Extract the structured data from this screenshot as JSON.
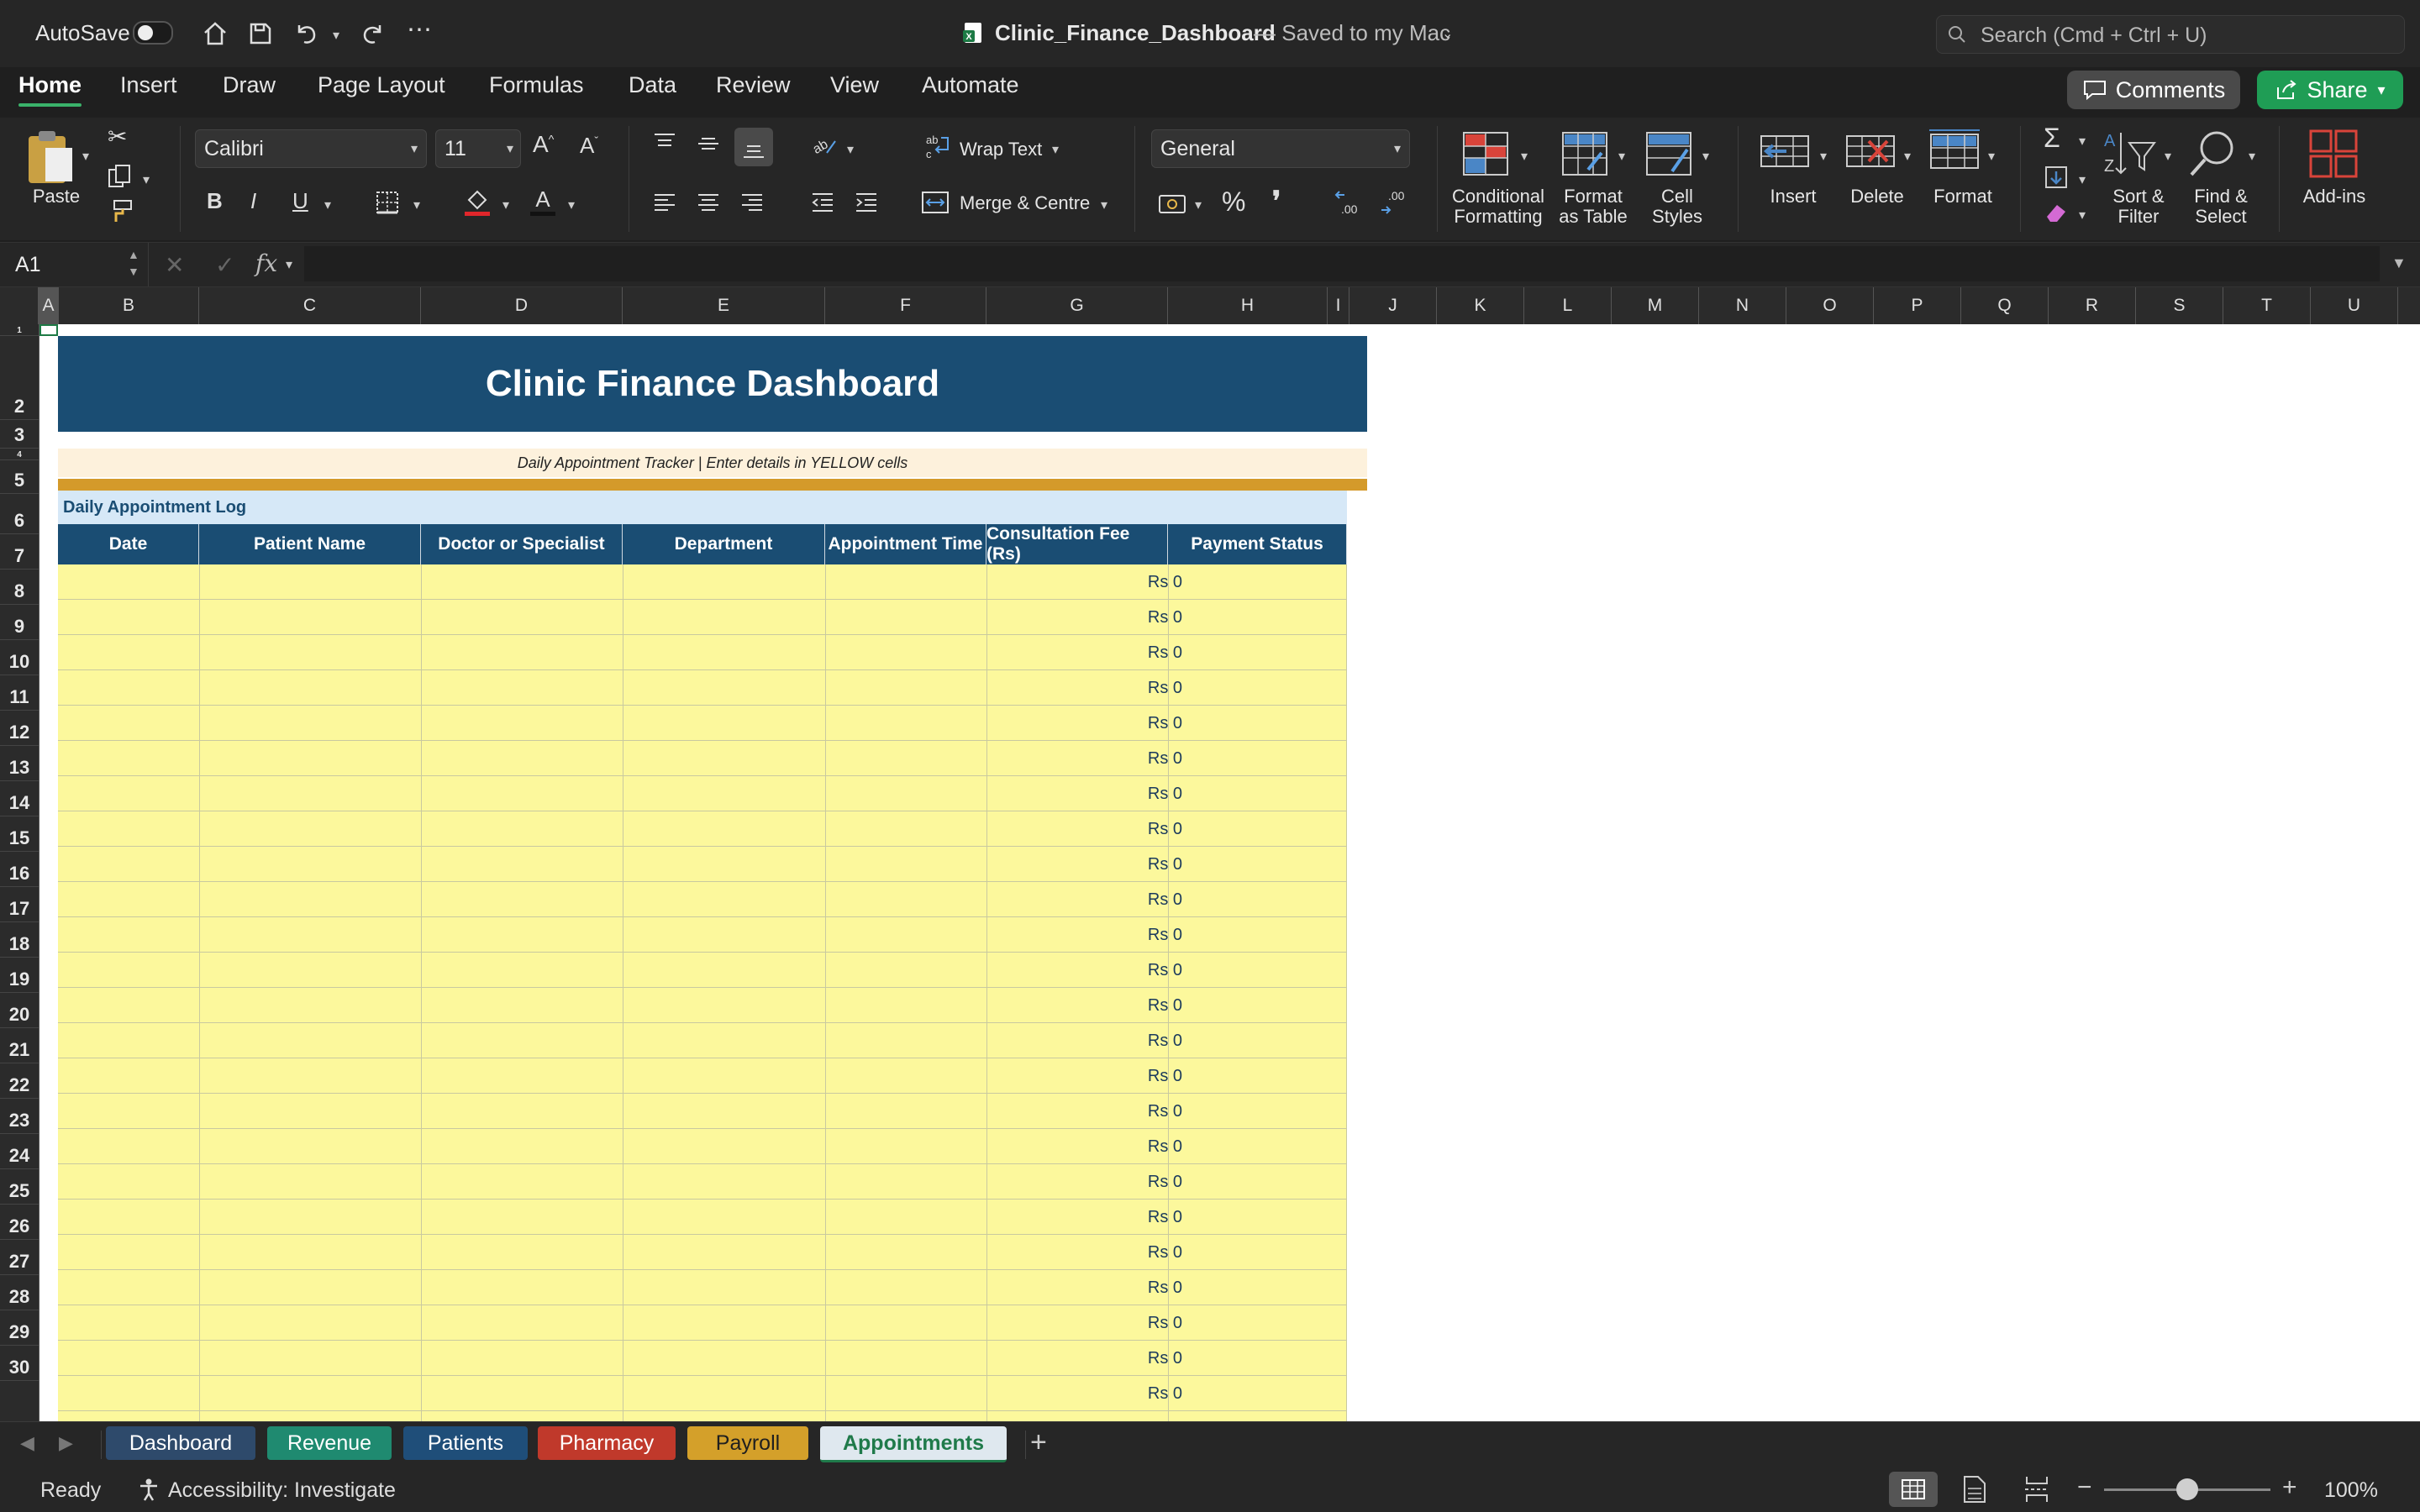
{
  "titlebar": {
    "autosave_label": "AutoSave",
    "doc_title": "Clinic_Finance_Dashboard",
    "save_status": "— Saved to my Mac",
    "search_placeholder": "Search (Cmd + Ctrl + U)"
  },
  "tabs": [
    "Home",
    "Insert",
    "Draw",
    "Page Layout",
    "Formulas",
    "Data",
    "Review",
    "View",
    "Automate"
  ],
  "actions": {
    "comments": "Comments",
    "share": "Share"
  },
  "ribbon": {
    "paste": "Paste",
    "font_name": "Calibri",
    "font_size": "11",
    "bold": "B",
    "italic": "I",
    "underline": "U",
    "wrap_text": "Wrap Text",
    "merge_centre": "Merge & Centre",
    "number_format": "General",
    "percent": "%",
    "comma": "❜",
    "conditional_formatting": [
      "Conditional",
      "Formatting"
    ],
    "format_as_table": [
      "Format",
      "as Table"
    ],
    "cell_styles": [
      "Cell",
      "Styles"
    ],
    "insert": "Insert",
    "delete": "Delete",
    "format": "Format",
    "sort_filter": [
      "Sort &",
      "Filter"
    ],
    "find_select": [
      "Find &",
      "Select"
    ],
    "addins": "Add-ins",
    "dec_inc": ".00",
    "dec_dec": ".00"
  },
  "formula_bar": {
    "name_box": "A1",
    "fx": "fx",
    "value": ""
  },
  "columns": [
    "A",
    "B",
    "C",
    "D",
    "E",
    "F",
    "G",
    "H",
    "I",
    "J",
    "K",
    "L",
    "M",
    "N",
    "O",
    "P",
    "Q",
    "R",
    "S",
    "T",
    "U"
  ],
  "rows": [
    "1",
    "2",
    "3",
    "4",
    "5",
    "6",
    "7",
    "8",
    "9",
    "10",
    "11",
    "12",
    "13",
    "14",
    "15",
    "16",
    "17",
    "18",
    "19",
    "20",
    "21",
    "22",
    "23",
    "24",
    "25",
    "26",
    "27",
    "28",
    "29",
    "30"
  ],
  "sheet": {
    "title": "Clinic Finance Dashboard",
    "subtitle": "Daily Appointment Tracker  |  Enter details in YELLOW cells",
    "section": "Daily Appointment Log",
    "headers": [
      "Date",
      "Patient Name",
      "Doctor or Specialist",
      "Department",
      "Appointment Time",
      "Consultation Fee (Rs)",
      "Payment Status"
    ],
    "fee_value": "Rs 0",
    "colors": {
      "title_bg": "#1a4d73",
      "accent_bar": "#d49a2a",
      "subtitle_bg": "#fdf1dc",
      "section_bg": "#d6e8f7",
      "input_bg": "#fcf89c"
    }
  },
  "sheet_tabs": [
    {
      "label": "Dashboard",
      "bg": "#2e4a6b",
      "fg": "#ffffff"
    },
    {
      "label": "Revenue",
      "bg": "#1f8a70",
      "fg": "#ffffff"
    },
    {
      "label": "Patients",
      "bg": "#1f4e79",
      "fg": "#ffffff"
    },
    {
      "label": "Pharmacy",
      "bg": "#c0392b",
      "fg": "#ffffff"
    },
    {
      "label": "Payroll",
      "bg": "#d4a02a",
      "fg": "#1f1f1f"
    },
    {
      "label": "Appointments",
      "bg": "#dfe8ef",
      "fg": "#1f7a4a"
    }
  ],
  "status": {
    "ready": "Ready",
    "accessibility": "Accessibility: Investigate",
    "zoom": "100%",
    "zoom_level": 1.0
  }
}
